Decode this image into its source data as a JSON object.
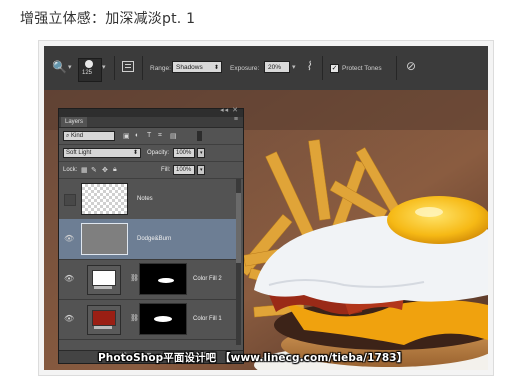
{
  "heading": "增强立体感：加深减淡pt. 1",
  "options_bar": {
    "brush_size": "125",
    "range_label": "Range:",
    "range_value": "Shadows",
    "exposure_label": "Exposure:",
    "exposure_value": "20%",
    "protect_tones_label": "Protect Tones",
    "protect_tones_checked": true
  },
  "layers_panel": {
    "tab_label": "Layers",
    "filter_kind": "Kind",
    "blend_mode": "Soft Light",
    "opacity_label": "Opacity:",
    "opacity_value": "100%",
    "lock_label": "Lock:",
    "fill_label": "Fill:",
    "fill_value": "100%",
    "layers": [
      {
        "name": "Notes",
        "visible": false
      },
      {
        "name": "Dodge&Burn",
        "visible": true,
        "selected": true
      },
      {
        "name": "Color Fill 2",
        "visible": true,
        "swatch": "#ffffff"
      },
      {
        "name": "Color Fill 1",
        "visible": true,
        "swatch": "#9a1f14"
      }
    ],
    "bottom_icons": [
      "link-icon",
      "fx-icon",
      "mask-icon",
      "adjustment-icon",
      "folder-icon",
      "new-layer-icon",
      "trash-icon"
    ]
  },
  "watermark": "PhotoShop平面设计吧 【www.linecg.com/tieba/1783】",
  "colors": {
    "panel_bg": "#535353",
    "selected_row": "#6d7e94",
    "options_bar_bg": "#3b3b3b"
  }
}
